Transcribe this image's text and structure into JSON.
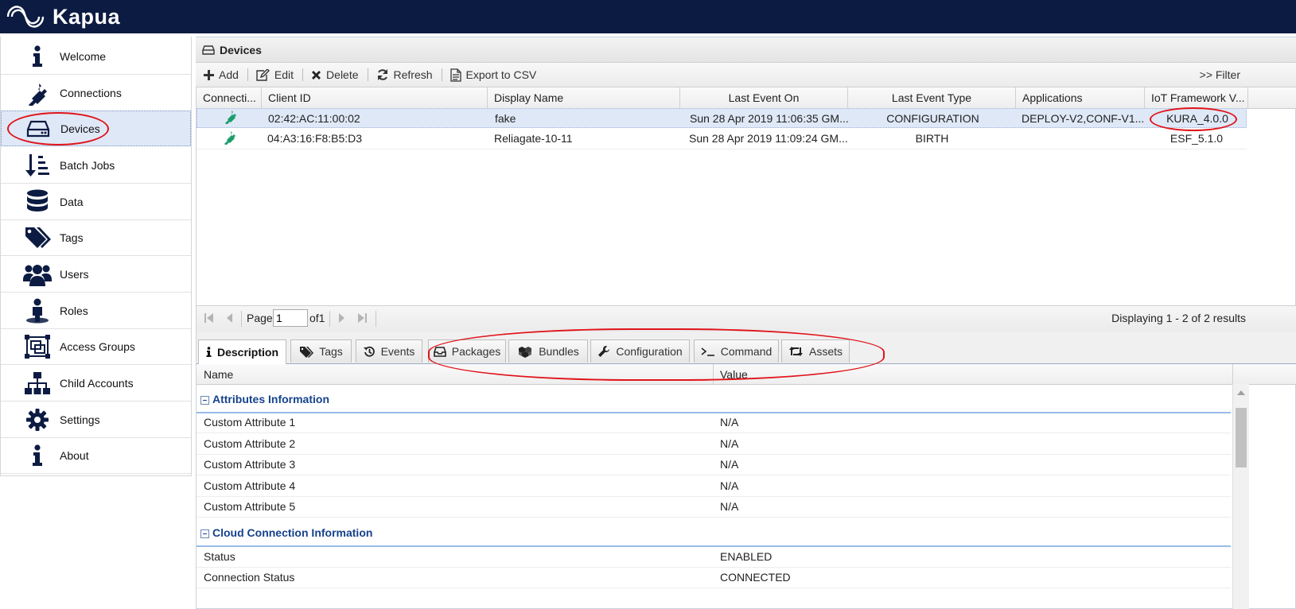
{
  "app": {
    "name": "Kapua"
  },
  "sidebar": {
    "items": [
      {
        "label": "Welcome",
        "icon": "info-icon"
      },
      {
        "label": "Connections",
        "icon": "plug-icon"
      },
      {
        "label": "Devices",
        "icon": "device-icon",
        "active": true
      },
      {
        "label": "Batch Jobs",
        "icon": "sort-icon"
      },
      {
        "label": "Data",
        "icon": "database-icon"
      },
      {
        "label": "Tags",
        "icon": "tags-icon"
      },
      {
        "label": "Users",
        "icon": "users-icon"
      },
      {
        "label": "Roles",
        "icon": "role-icon"
      },
      {
        "label": "Access Groups",
        "icon": "group-icon"
      },
      {
        "label": "Child Accounts",
        "icon": "sitemap-icon"
      },
      {
        "label": "Settings",
        "icon": "gear-icon"
      },
      {
        "label": "About",
        "icon": "info-icon"
      }
    ]
  },
  "panel": {
    "title": "Devices"
  },
  "toolbar": {
    "add": "Add",
    "edit": "Edit",
    "delete": "Delete",
    "refresh": "Refresh",
    "export": "Export to CSV",
    "filter": ">> Filter"
  },
  "grid": {
    "columns": [
      "Connecti...",
      "Client ID",
      "Display Name",
      "Last Event On",
      "Last Event Type",
      "Applications",
      "IoT Framework V..."
    ],
    "rows": [
      {
        "client_id": "02:42:AC:11:00:02",
        "display_name": "fake",
        "last_event_on": "Sun 28 Apr 2019 11:06:35 GM...",
        "last_event_type": "CONFIGURATION",
        "applications": "DEPLOY-V2,CONF-V1...",
        "framework": "KURA_4.0.0",
        "selected": true
      },
      {
        "client_id": "04:A3:16:F8:B5:D3",
        "display_name": "Reliagate-10-11",
        "last_event_on": "Sun 28 Apr 2019 11:09:24 GM...",
        "last_event_type": "BIRTH",
        "applications": "",
        "framework": "ESF_5.1.0",
        "selected": false
      }
    ]
  },
  "pager": {
    "page_label": "Page",
    "page_value": "1",
    "of_label": "of1",
    "displaying": "Displaying 1 - 2 of 2 results"
  },
  "tabs": [
    "Description",
    "Tags",
    "Events",
    "Packages",
    "Bundles",
    "Configuration",
    "Command",
    "Assets"
  ],
  "details": {
    "name_header": "Name",
    "value_header": "Value",
    "sections": [
      {
        "title": "Attributes Information",
        "rows": [
          {
            "name": "Custom Attribute 1",
            "value": "N/A"
          },
          {
            "name": "Custom Attribute 2",
            "value": "N/A"
          },
          {
            "name": "Custom Attribute 3",
            "value": "N/A"
          },
          {
            "name": "Custom Attribute 4",
            "value": "N/A"
          },
          {
            "name": "Custom Attribute 5",
            "value": "N/A"
          }
        ]
      },
      {
        "title": "Cloud Connection Information",
        "rows": [
          {
            "name": "Status",
            "value": "ENABLED"
          },
          {
            "name": "Connection Status",
            "value": "CONNECTED"
          }
        ]
      }
    ]
  },
  "colors": {
    "topbar": "#0c1b42",
    "selection": "#dfe8f6",
    "section_title": "#15428b",
    "connected_plug": "#1b9e6b",
    "annotation": "#e0131a"
  }
}
